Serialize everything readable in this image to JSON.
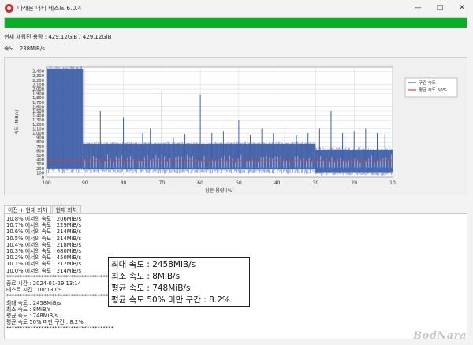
{
  "window": {
    "title": "나래온 더티 테스트 6.0.4",
    "controls": {
      "minimize": "—",
      "maximize": "□",
      "close": "✕"
    }
  },
  "progress": {
    "fraction": 1.0,
    "color": "#06b025"
  },
  "info": {
    "filled_capacity": "현재 채워진 용량 : 429.12GiB / 429.12GiB",
    "speed": "속도 : 238MiB/s"
  },
  "tabs": [
    {
      "label": "이전 + 현재 회차",
      "active": true
    },
    {
      "label": "현재 회차",
      "active": false
    }
  ],
  "log_lines": [
    "10.8% 에서의 속도 : 206MiB/s",
    "10.7% 에서의 속도 : 229MiB/s",
    "10.6% 에서의 속도 : 214MiB/s",
    "10.5% 에서의 속도 : 214MiB/s",
    "10.4% 에서의 속도 : 218MiB/s",
    "10.3% 에서의 속도 : 680MiB/s",
    "10.2% 에서의 속도 : 450MiB/s",
    "10.1% 에서의 속도 : 212MiB/s",
    "10.0% 에서의 속도 : 214MiB/s",
    "****************************************",
    "종료 시간 : 2024-01-29 13:14",
    "테스트 시간 : 00:13:09",
    "****************************************",
    "최대 속도 : 2458MiB/s",
    "최소 속도 : 8MiB/s",
    "평균 속도 : 748MiB/s",
    "평균 속도 50% 미만 구간 : 8.2%",
    "****************************************"
  ],
  "summary": {
    "max": "최대 속도 : 2458MiB/s",
    "min": "최소 속도 : 8MiB/s",
    "avg": "평균 속도 : 748MiB/s",
    "below_half": "평균 속도 50% 미만 구간 : 8.2%"
  },
  "watermark": "BodNara",
  "chart_data": {
    "type": "line",
    "xlabel": "남은 용량 (%)",
    "ylabel": "속도 (MiB/s)",
    "xlim": [
      100,
      10
    ],
    "ylim": [
      0,
      2500
    ],
    "x_ticks": [
      "100",
      "90",
      "80",
      "70",
      "60",
      "50",
      "40",
      "30",
      "20",
      "10"
    ],
    "y_ticks": [
      "0",
      "100",
      "200",
      "300",
      "400",
      "500",
      "600",
      "700",
      "800",
      "900",
      "1,000",
      "1,100",
      "1,200",
      "1,300",
      "1,400",
      "1,500",
      "1,600",
      "1,700",
      "1,800",
      "1,900",
      "2,000",
      "2,100",
      "2,200",
      "2,300",
      "2,400"
    ],
    "grid": true,
    "legend_position": "right",
    "series": [
      {
        "name": "구간 속도",
        "color": "#3f5fa8",
        "segments": [
          {
            "x_from": 100,
            "x_to": 90.5,
            "y_low": 200,
            "y_high": 2458
          },
          {
            "x_from": 90.5,
            "x_to": 30,
            "y_low": 180,
            "y_high": 750
          },
          {
            "x_from": 30,
            "x_to": 10,
            "y_low": 100,
            "y_high": 620
          }
        ],
        "spikes": [
          {
            "x": 86,
            "y": 1500
          },
          {
            "x": 80,
            "y": 1350
          },
          {
            "x": 75,
            "y": 1000
          },
          {
            "x": 73,
            "y": 1100
          },
          {
            "x": 70,
            "y": 1950
          },
          {
            "x": 67,
            "y": 900
          },
          {
            "x": 64,
            "y": 980
          },
          {
            "x": 60,
            "y": 1880
          },
          {
            "x": 57,
            "y": 1000
          },
          {
            "x": 54,
            "y": 1050
          },
          {
            "x": 50,
            "y": 1300
          },
          {
            "x": 47,
            "y": 950
          },
          {
            "x": 44,
            "y": 1100
          },
          {
            "x": 41,
            "y": 1000
          },
          {
            "x": 38,
            "y": 1050
          },
          {
            "x": 35,
            "y": 950
          },
          {
            "x": 32,
            "y": 1000
          },
          {
            "x": 29,
            "y": 1100
          },
          {
            "x": 26,
            "y": 1500
          },
          {
            "x": 23,
            "y": 1000
          },
          {
            "x": 20,
            "y": 1050
          },
          {
            "x": 17,
            "y": 1100
          },
          {
            "x": 14,
            "y": 1000
          },
          {
            "x": 12,
            "y": 980
          }
        ]
      },
      {
        "name": "평균 속도 50%",
        "color": "#e03a3a",
        "values": [
          {
            "x": 100,
            "y": 374
          },
          {
            "x": 10,
            "y": 374
          }
        ]
      }
    ]
  }
}
